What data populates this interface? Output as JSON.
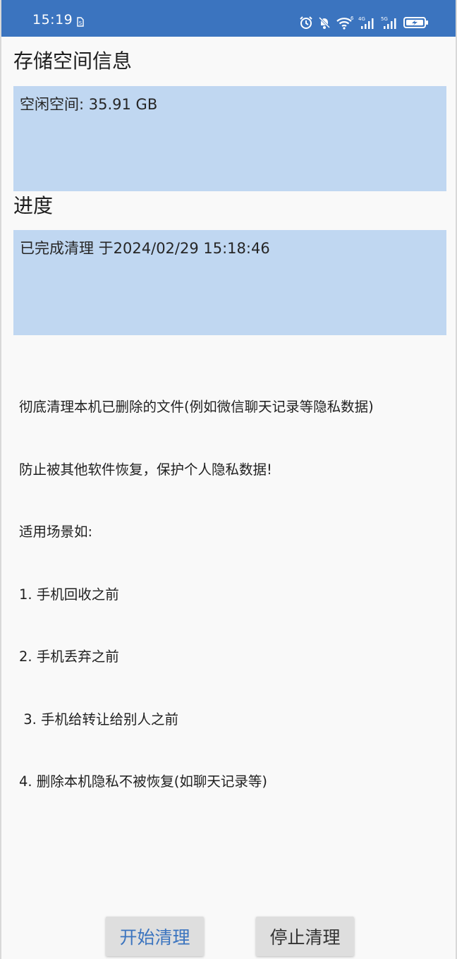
{
  "status_bar": {
    "time": "15:19",
    "network_4g": "4G",
    "network_5g": "5G",
    "wifi_badge": "6",
    "accent_color": "#3b74bf"
  },
  "storage": {
    "title": "存储空间信息",
    "free_space": "空闲空间: 35.91 GB"
  },
  "progress": {
    "title": "进度",
    "status": "已完成清理 于2024/02/29 15:18:46"
  },
  "description": {
    "lines": [
      "彻底清理本机已删除的文件(例如微信聊天记录等隐私数据)",
      "防止被其他软件恢复，保护个人隐私数据!",
      "适用场景如:",
      "1. 手机回收之前",
      "2. 手机丢弃之前",
      " 3. 手机给转让给别人之前",
      "4. 删除本机隐私不被恢复(如聊天记录等)"
    ]
  },
  "actions": {
    "start_label": "开始清理",
    "stop_label": "停止清理"
  }
}
